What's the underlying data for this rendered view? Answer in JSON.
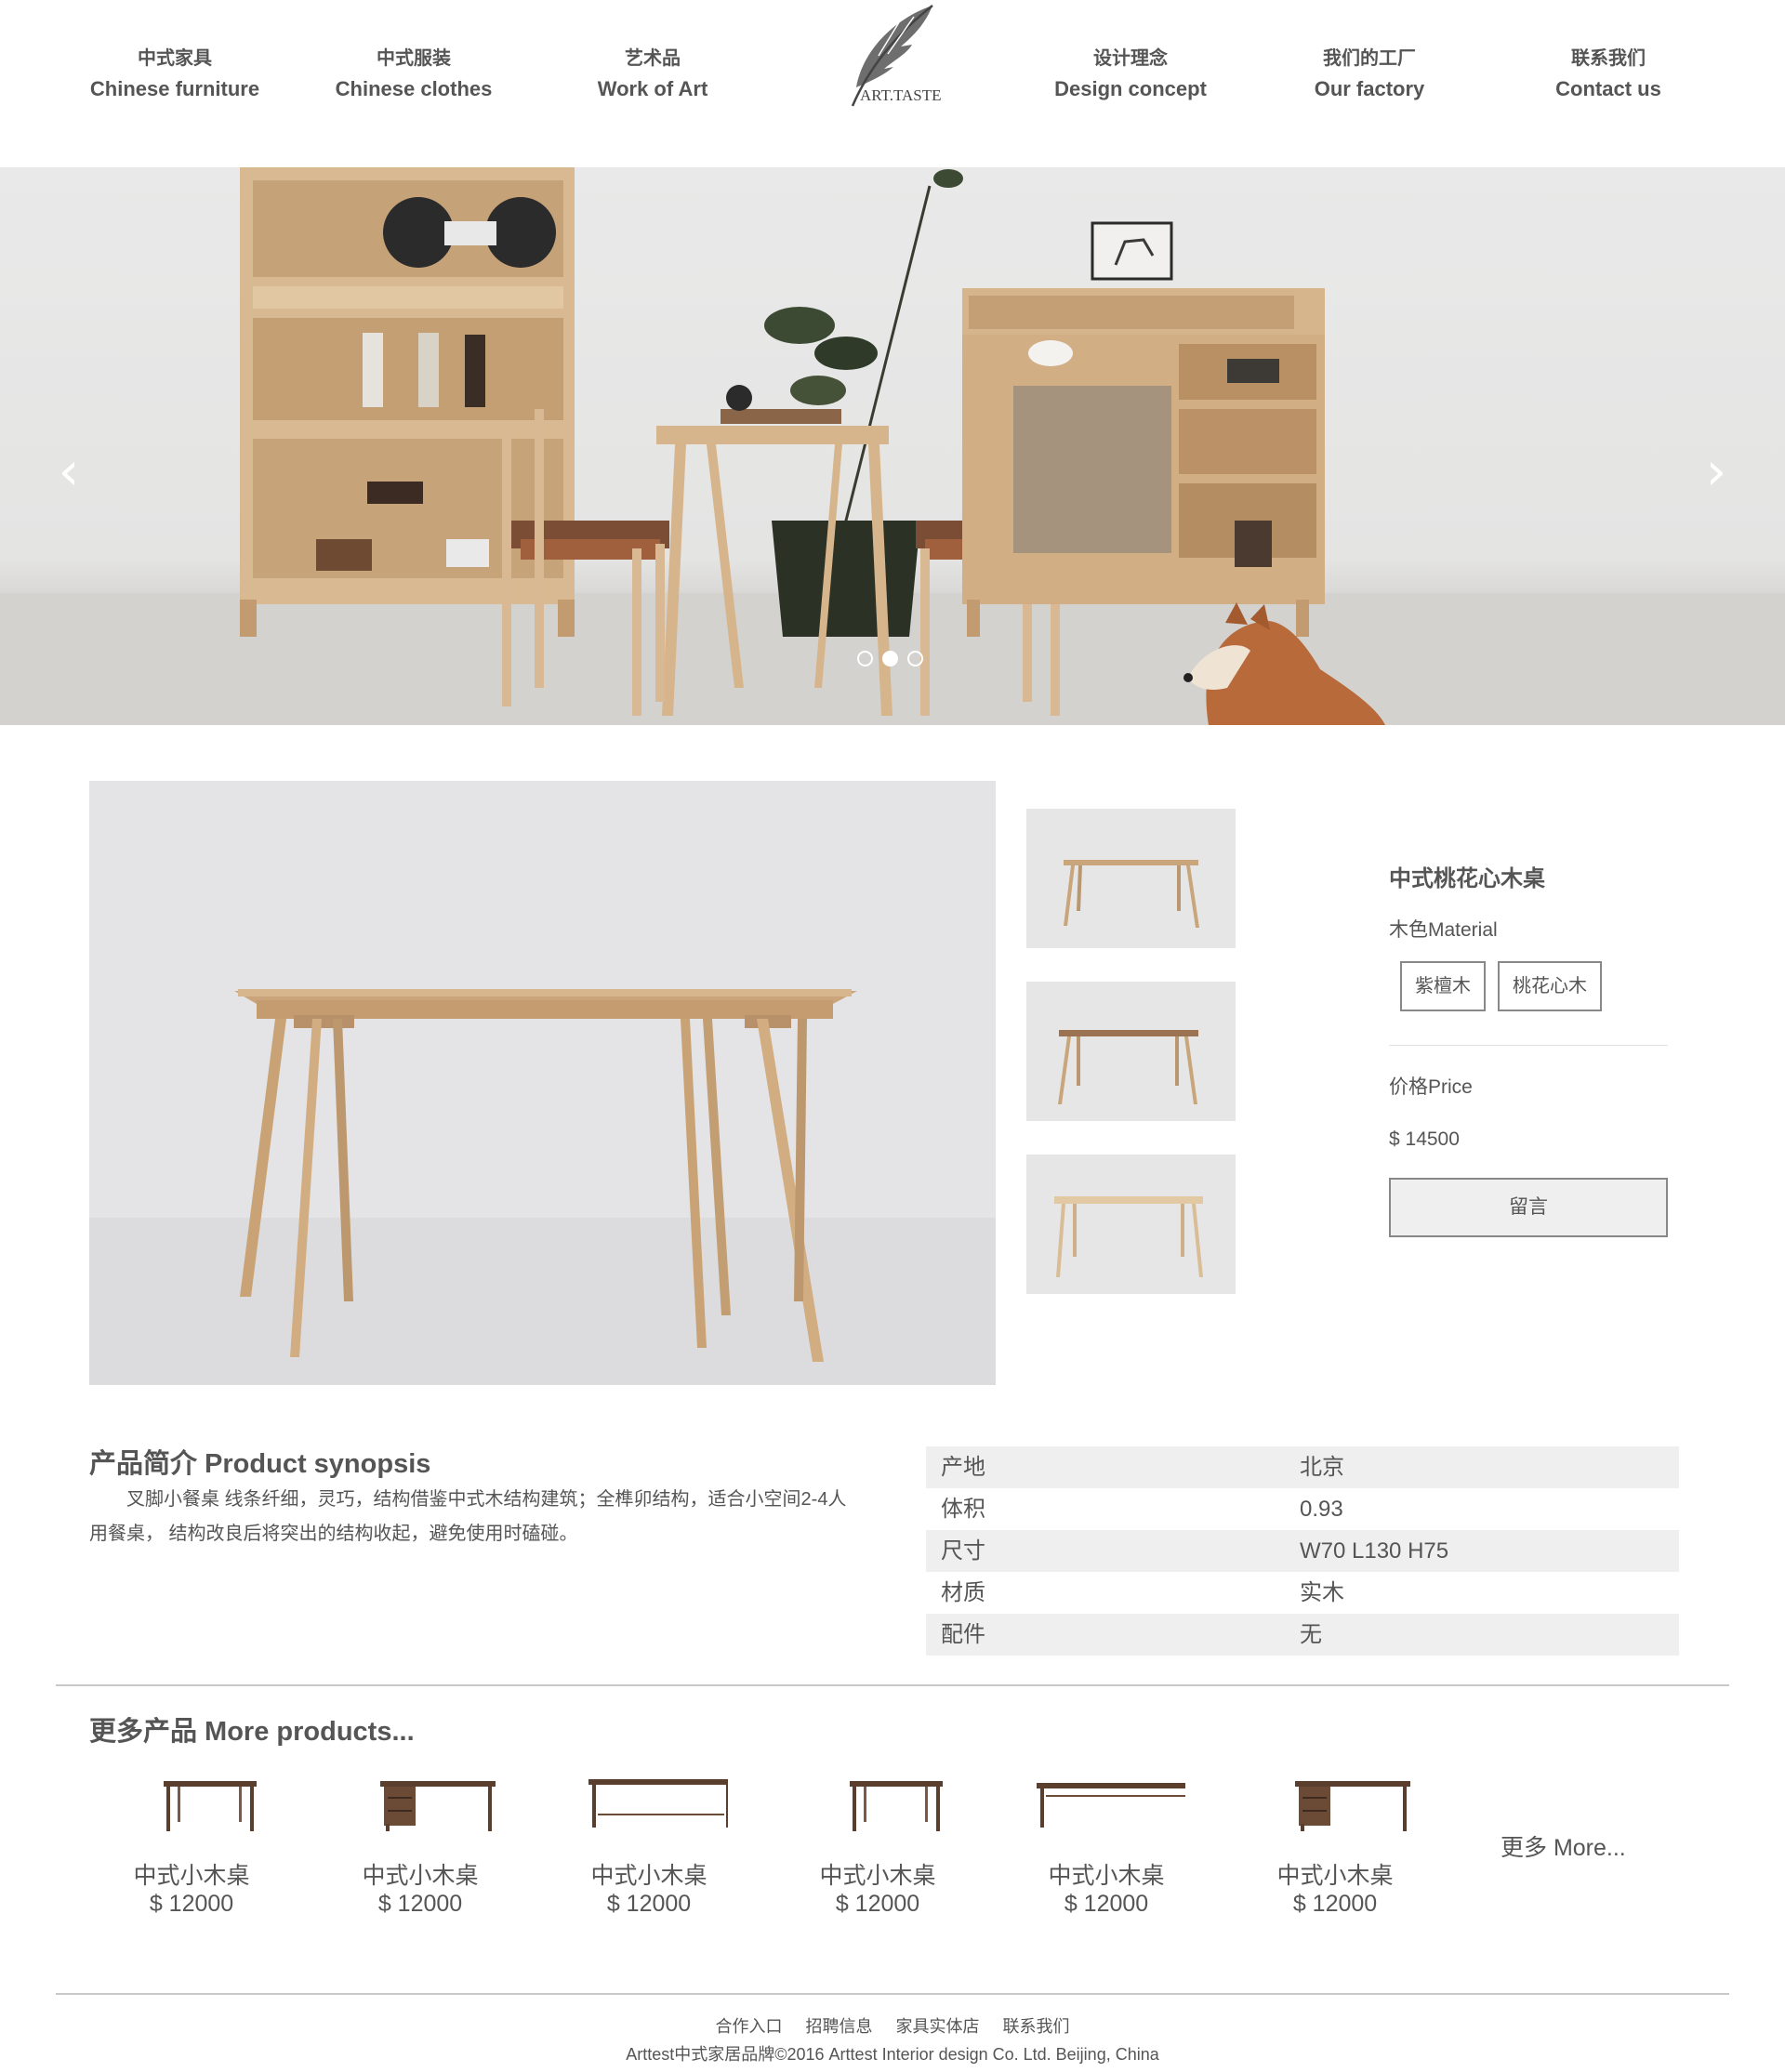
{
  "nav": {
    "items": [
      {
        "zh": "中式家具",
        "en": "Chinese furniture"
      },
      {
        "zh": "中式服装",
        "en": "Chinese clothes"
      },
      {
        "zh": "艺术品",
        "en": "Work of Art"
      },
      {
        "zh": "设计理念",
        "en": "Design concept"
      },
      {
        "zh": "我们的工厂",
        "en": "Our factory"
      },
      {
        "zh": "联系我们",
        "en": "Contact us"
      }
    ],
    "logo_text": "ART.TASTE"
  },
  "carousel": {
    "prev_icon": "chevron-left-icon",
    "next_icon": "chevron-right-icon",
    "prev_glyph": "‹",
    "next_glyph": "›",
    "slide_count": 3,
    "active_slide": 2
  },
  "product": {
    "title": "中式桃花心木桌",
    "material_label": "木色Material",
    "materials": [
      "紫檀木",
      "桃花心木"
    ],
    "price_label": "价格Price",
    "price": "$ 14500",
    "message_button": "留言"
  },
  "synopsis": {
    "heading": "产品简介 Product synopsis",
    "text": "叉脚小餐桌 线条纤细，灵巧，结构借鉴中式木结构建筑；全榫卯结构，适合小空间2-4人用餐桌， 结构改良后将突出的结构收起，避免使用时磕碰。"
  },
  "specs": [
    {
      "key": "产地",
      "value": "北京"
    },
    {
      "key": "体积",
      "value": "0.93"
    },
    {
      "key": "尺寸",
      "value": "W70 L130 H75"
    },
    {
      "key": "材质",
      "value": "实木"
    },
    {
      "key": "配件",
      "value": "无"
    }
  ],
  "more_products": {
    "heading": "更多产品 More products...",
    "items": [
      {
        "name": "中式小木桌",
        "price": "$ 12000"
      },
      {
        "name": "中式小木桌",
        "price": "$ 12000"
      },
      {
        "name": "中式小木桌",
        "price": "$ 12000"
      },
      {
        "name": "中式小木桌",
        "price": "$ 12000"
      },
      {
        "name": "中式小木桌",
        "price": "$ 12000"
      },
      {
        "name": "中式小木桌",
        "price": "$ 12000"
      }
    ],
    "more_link": "更多 More..."
  },
  "footer": {
    "links": [
      "合作入口",
      "招聘信息",
      "家具实体店",
      "联系我们"
    ],
    "copyright": "Arttest中式家居品牌©2016 Arttest Interior design Co. Ltd. Beijing, China"
  },
  "colors": {
    "text": "#555555",
    "wood": "#c9a47a",
    "wood_dark": "#6b4a35",
    "background": "#ffffff",
    "table_shade": "#efefef"
  }
}
